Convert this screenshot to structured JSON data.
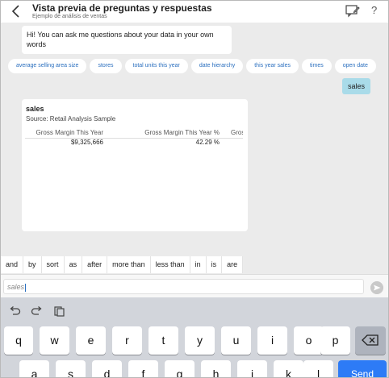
{
  "header": {
    "title": "Vista previa de preguntas y respuestas",
    "subtitle": "Ejemplo de análisis de ventas",
    "help": "?"
  },
  "chat": {
    "welcome": "Hi! You can ask me questions about your data in your own words",
    "suggestions": [
      "average selling area size",
      "stores",
      "total units this year",
      "date hierarchy",
      "this year sales",
      "times",
      "open date"
    ],
    "user_query": "sales"
  },
  "result": {
    "title": "sales",
    "source": "Source: Retail Analysis Sample",
    "columns": [
      "Gross Margin This Year",
      "Gross Margin This Year %",
      "Gross Margi"
    ],
    "row": [
      "$9,325,666",
      "42.29 %",
      ""
    ],
    "scroll_left": "<",
    "scroll_right": ">"
  },
  "keywords": [
    "and",
    "by",
    "sort",
    "as",
    "after",
    "more than",
    "less than",
    "in",
    "is",
    "are"
  ],
  "input": {
    "value": "sales"
  },
  "keyboard": {
    "row1": [
      "q",
      "w",
      "e",
      "r",
      "t",
      "y",
      "u",
      "i",
      "o",
      "p"
    ],
    "row2": [
      "a",
      "s",
      "d",
      "f",
      "g",
      "h",
      "j",
      "k",
      "l"
    ],
    "send": "Send"
  },
  "colors": {
    "accent": "#2a6fbf",
    "user_bubble": "#a9dbe9",
    "send_key": "#2d7bf6",
    "keyboard_bg": "#d2d5db"
  }
}
